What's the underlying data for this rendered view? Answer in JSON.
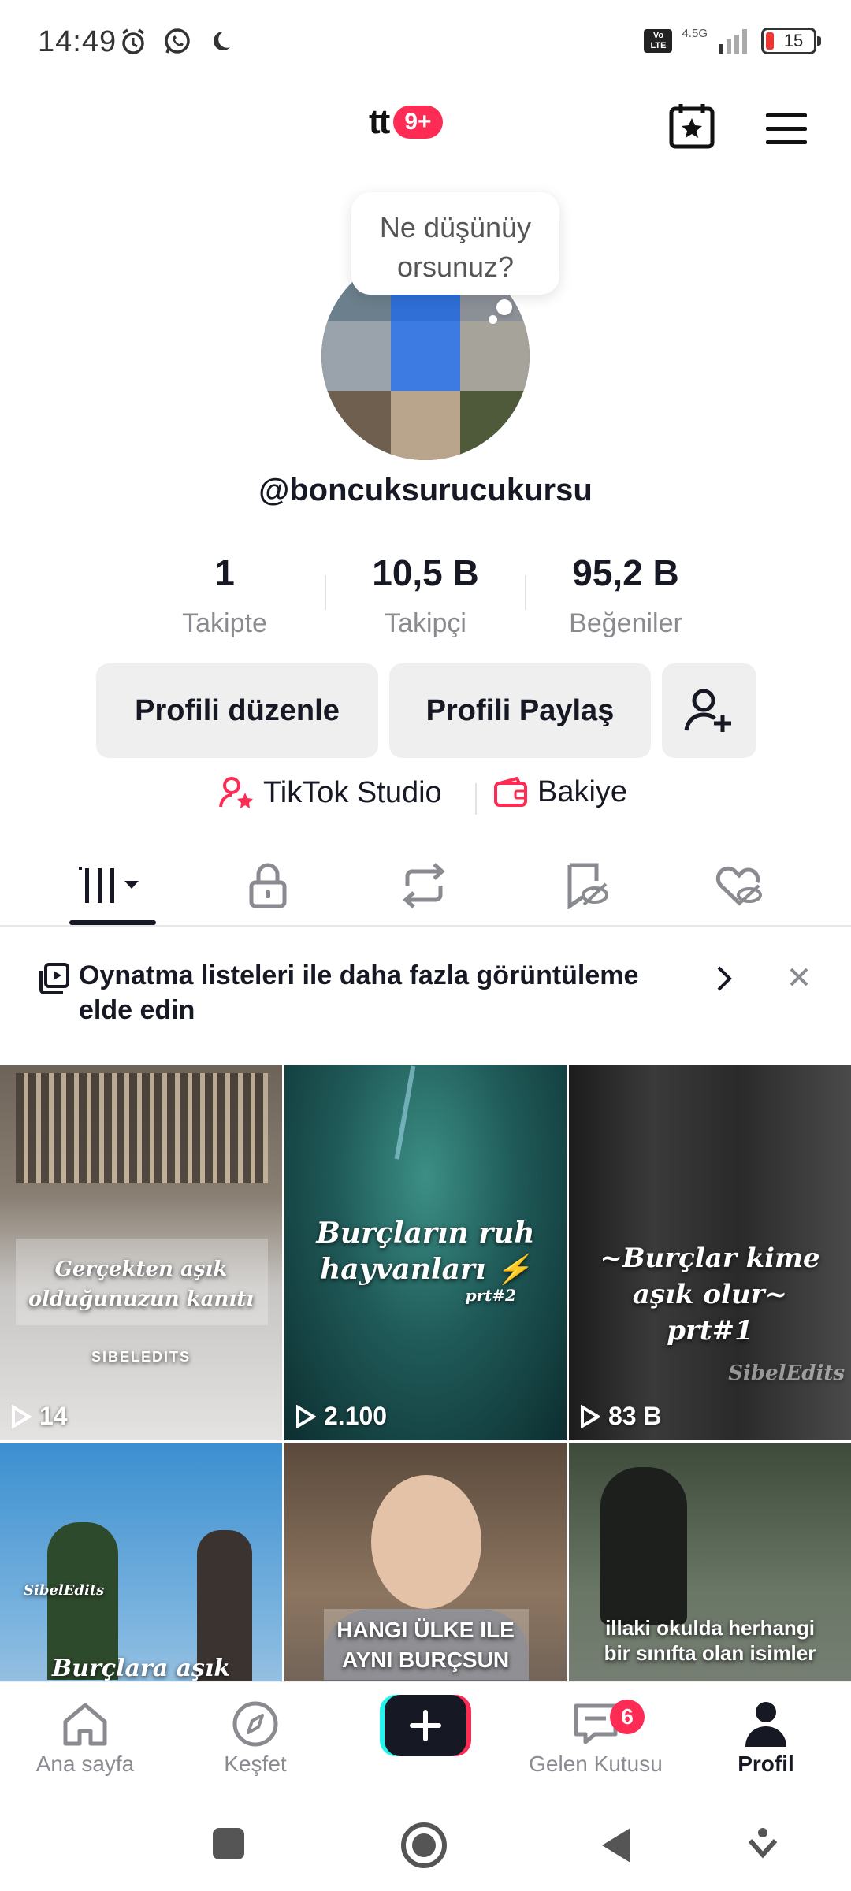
{
  "status_bar": {
    "time": "14:49",
    "network": "4.5G",
    "volte": "Vo LTE",
    "battery": "15"
  },
  "header": {
    "logo_text": "tt",
    "badge": "9+"
  },
  "profile": {
    "bubble_text": "Ne düşünüy orsunuz?",
    "username": "@boncuksurucukursu",
    "stats": [
      {
        "value": "1",
        "label": "Takipte"
      },
      {
        "value": "10,5 B",
        "label": "Takipçi"
      },
      {
        "value": "95,2 B",
        "label": "Beğeniler"
      }
    ],
    "edit_button": "Profili düzenle",
    "share_button": "Profili Paylaş",
    "studio_label": "TikTok Studio",
    "balance_label": "Bakiye"
  },
  "banner": {
    "text": "Oynatma listeleri ile daha fazla görüntüleme elde edin"
  },
  "videos": [
    {
      "caption": "Gerçekten aşık olduğunuzun kanıtı",
      "watermark": "SIBELEDITS",
      "views": "14"
    },
    {
      "caption": "Burçların ruh hayvanları ⚡",
      "sub": "prt#2",
      "views": "2.100"
    },
    {
      "caption": "~Burçlar kime aşık olur~ prt#1",
      "watermark": "SibelEdits",
      "views": "83 B"
    },
    {
      "caption": "Burçlara aşık",
      "watermark": "SibelEdits",
      "views": ""
    },
    {
      "caption": "HANGI ÜLKE ILE AYNI BURÇSUN",
      "views": ""
    },
    {
      "caption": "illaki okulda herhangi bir sınıfta olan isimler",
      "views": ""
    }
  ],
  "bottom_nav": {
    "home": "Ana sayfa",
    "discover": "Keşfet",
    "inbox": "Gelen Kutusu",
    "inbox_badge": "6",
    "profile": "Profil"
  },
  "colors": {
    "accent": "#fe2c55",
    "text": "#161823",
    "muted": "#8a8b91"
  }
}
